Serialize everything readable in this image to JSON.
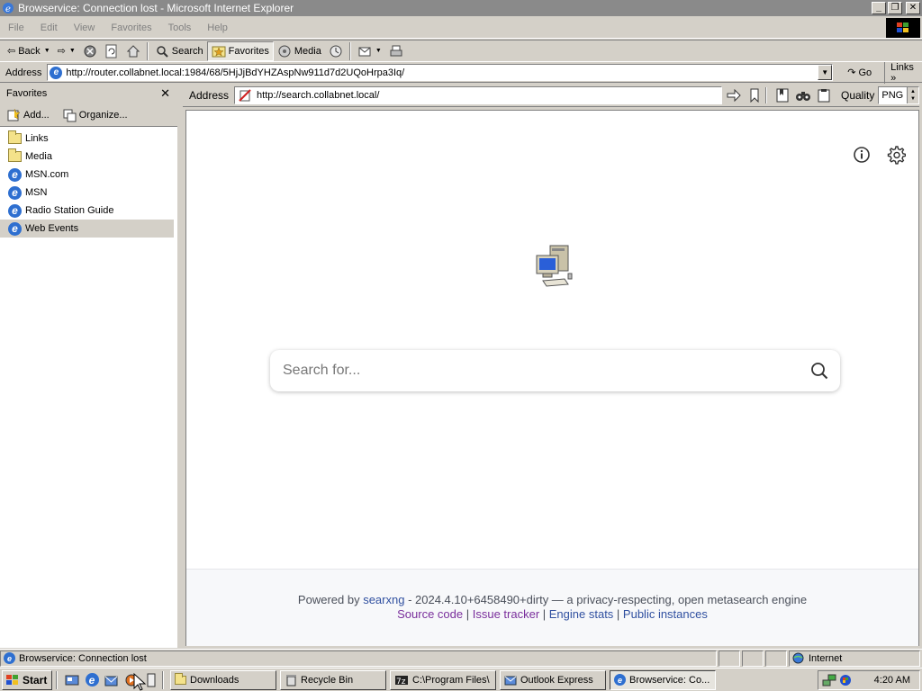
{
  "window": {
    "title": "Browservice: Connection lost - Microsoft Internet Explorer"
  },
  "menu": [
    "File",
    "Edit",
    "View",
    "Favorites",
    "Tools",
    "Help"
  ],
  "toolbar": {
    "back": "Back",
    "search": "Search",
    "favorites": "Favorites",
    "media": "Media"
  },
  "address_bar": {
    "label": "Address",
    "url": "http://router.collabnet.local:1984/68/5HjJjBdYHZAspNw911d7d2UQoHrpa3Iq/",
    "go": "Go",
    "links": "Links"
  },
  "favorites_panel": {
    "title": "Favorites",
    "add": "Add...",
    "organize": "Organize...",
    "items": [
      {
        "label": "Links",
        "type": "folder"
      },
      {
        "label": "Media",
        "type": "folder"
      },
      {
        "label": "MSN.com",
        "type": "page"
      },
      {
        "label": "MSN",
        "type": "page"
      },
      {
        "label": "Radio Station Guide",
        "type": "page"
      },
      {
        "label": "Web Events",
        "type": "page"
      }
    ]
  },
  "browservice": {
    "address_label": "Address",
    "url": "http://search.collabnet.local/",
    "quality_label": "Quality",
    "quality_value": "PNG"
  },
  "page": {
    "search_placeholder": "Search for...",
    "footer": {
      "powered_by": "Powered by",
      "engine": "searxng",
      "version_text": " - 2024.4.10+6458490+dirty — a privacy-respecting, open metasearch engine",
      "links": [
        "Source code",
        "Issue tracker",
        "Engine stats",
        "Public instances"
      ],
      "separator": " | "
    }
  },
  "status_bar": {
    "message": "Browservice: Connection lost",
    "zone": "Internet"
  },
  "taskbar": {
    "start": "Start",
    "tasks": [
      "Downloads",
      "Recycle Bin",
      "C:\\Program Files\\",
      "Outlook Express",
      "Browservice: Co..."
    ],
    "clock": "4:20 AM"
  }
}
